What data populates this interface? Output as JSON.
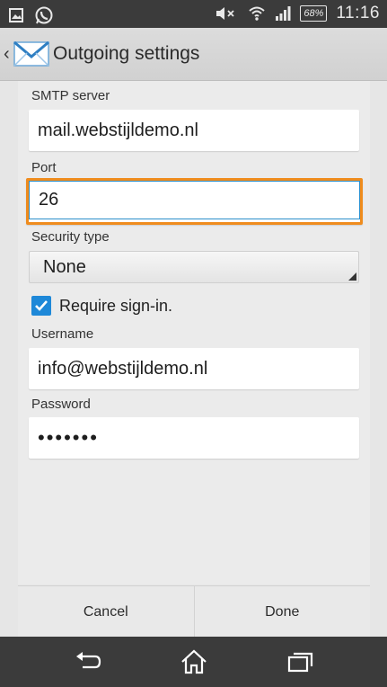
{
  "statusbar": {
    "battery": "68%",
    "time": "11:16",
    "icons": [
      "image-icon",
      "whatsapp-icon",
      "mute-icon",
      "wifi-icon",
      "signal-icon",
      "battery-icon"
    ]
  },
  "actionbar": {
    "title": "Outgoing settings",
    "app_icon": "mail-icon"
  },
  "form": {
    "smtp": {
      "label": "SMTP server",
      "value": "mail.webstijldemo.nl"
    },
    "port": {
      "label": "Port",
      "value": "26"
    },
    "security": {
      "label": "Security type",
      "value": "None"
    },
    "require_signin": {
      "label": "Require sign-in.",
      "checked": true
    },
    "username": {
      "label": "Username",
      "value": "info@webstijldemo.nl"
    },
    "password": {
      "label": "Password",
      "value": "•••••••"
    }
  },
  "buttons": {
    "cancel": "Cancel",
    "done": "Done"
  },
  "navbar": {
    "icons": [
      "back-icon",
      "home-icon",
      "recent-apps-icon"
    ]
  },
  "colors": {
    "focus_outer": "#ef8c1e",
    "focus_inner": "#2d8fcb",
    "checkbox": "#1e88d8",
    "statusbar": "#3b3b3b"
  }
}
